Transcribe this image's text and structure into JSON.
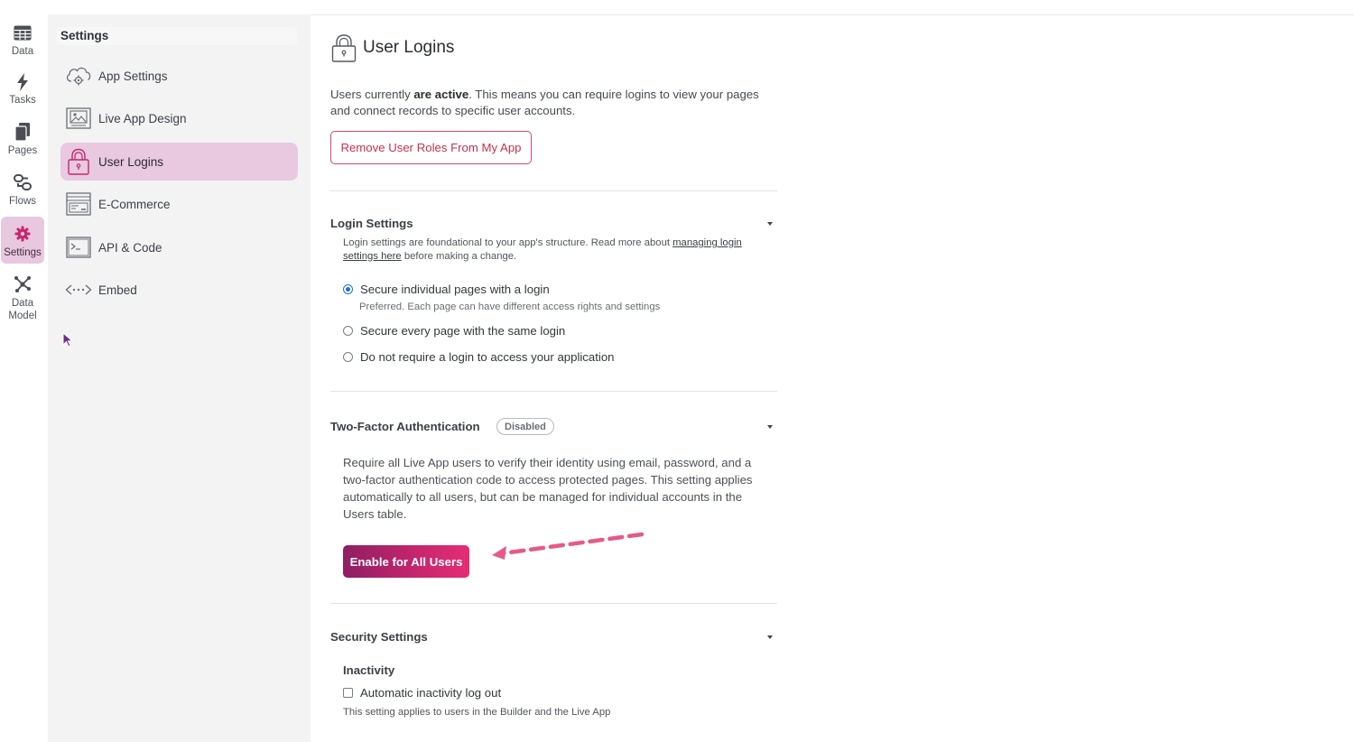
{
  "rail": {
    "items": [
      {
        "label": "Data",
        "icon": "table-icon"
      },
      {
        "label": "Tasks",
        "icon": "lightning-icon"
      },
      {
        "label": "Pages",
        "icon": "pages-icon"
      },
      {
        "label": "Flows",
        "icon": "flows-icon"
      },
      {
        "label": "Settings",
        "icon": "gear-icon",
        "active": true
      },
      {
        "label": "Data\nModel",
        "icon": "data-model-icon"
      }
    ]
  },
  "panel": {
    "title": "Settings",
    "items": [
      {
        "label": "App Settings",
        "icon": "cloud-gear-icon"
      },
      {
        "label": "Live App Design",
        "icon": "image-icon"
      },
      {
        "label": "User Logins",
        "icon": "lock-icon",
        "active": true
      },
      {
        "label": "E-Commerce",
        "icon": "ecommerce-icon"
      },
      {
        "label": "API & Code",
        "icon": "terminal-icon"
      },
      {
        "label": "Embed",
        "icon": "embed-icon"
      }
    ]
  },
  "main": {
    "title": "User Logins",
    "intro_prefix": "Users currently ",
    "intro_bold": "are active",
    "intro_suffix": ". This means you can require logins to view your pages and connect records to specific user accounts.",
    "remove_button": "Remove User Roles From My App",
    "login_settings": {
      "title": "Login Settings",
      "help_prefix": "Login settings are foundational to your app's structure. Read more about ",
      "help_link": "managing login settings here",
      "help_suffix": " before making a change.",
      "options": [
        {
          "label": "Secure individual pages with a login",
          "selected": true,
          "sublabel": "Preferred. Each page can have different access rights and settings"
        },
        {
          "label": "Secure every page with the same login",
          "selected": false
        },
        {
          "label": "Do not require a login to access your application",
          "selected": false
        }
      ]
    },
    "two_factor": {
      "title": "Two-Factor Authentication",
      "badge": "Disabled",
      "description": "Require all Live App users to verify their identity using email, password, and a two-factor authentication code to access protected pages. This setting applies automatically to all users, but can be managed for individual accounts in the Users table.",
      "button": "Enable for All Users"
    },
    "security": {
      "title": "Security Settings",
      "inactivity_heading": "Inactivity",
      "checkbox_label": "Automatic inactivity log out",
      "checkbox_checked": false,
      "help": "This setting applies to users in the Builder and the Live App"
    }
  },
  "colors": {
    "accent": "#c7266d",
    "active_bg": "#e8c9e0",
    "radio_selected": "#1f6fd0",
    "arrow": "#e65a86"
  }
}
